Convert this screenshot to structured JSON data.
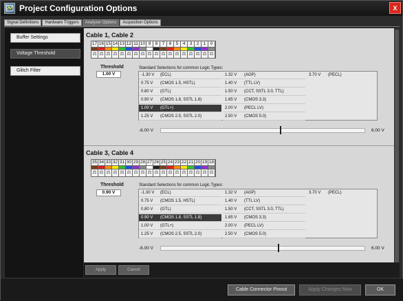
{
  "window": {
    "title": "Project Configuration Options",
    "close_label": "X"
  },
  "tabs": [
    {
      "label": "Signal Definitions",
      "active": false
    },
    {
      "label": "Hardware Triggers",
      "active": false
    },
    {
      "label": "Analyzer Options",
      "active": true
    },
    {
      "label": "Acquisition Options",
      "active": false
    }
  ],
  "sidebar": {
    "items": [
      {
        "label": "Buffer Settings",
        "active": false
      },
      {
        "label": "Voltage Threshold",
        "active": true
      },
      {
        "label": "Glitch Filter",
        "active": false
      }
    ]
  },
  "sections": [
    {
      "title": "Cable 1, Cable 2",
      "channels": [
        "17",
        "16",
        "15",
        "14",
        "13",
        "12",
        "11",
        "10",
        "9",
        "8",
        "7",
        "6",
        "5",
        "4",
        "3",
        "2",
        "1",
        "0"
      ],
      "channel_colors": [
        "#7a3e1c",
        "#e02020",
        "#ff8c00",
        "#ffe800",
        "#30c030",
        "#2050e0",
        "#9030d0",
        "#888888",
        "#ffffff",
        "#222222",
        "#7a3e1c",
        "#e02020",
        "#ff8c00",
        "#ffe800",
        "#30c030",
        "#2050e0",
        "#9030d0",
        "#888888"
      ],
      "threshold_label": "Threshold",
      "threshold_value": "1.00 V",
      "std_label": "Standard Selections for common Logic Types:",
      "options": [
        {
          "v": "-1.30 V",
          "t": "(ECL)"
        },
        {
          "v": "0.75 V",
          "t": "(CMOS 1.5, HSTL)"
        },
        {
          "v": "0.80 V",
          "t": "(GTL)"
        },
        {
          "v": "0.90 V",
          "t": "(CMOS 1.8, SSTL 1.8)"
        },
        {
          "v": "1.00 V",
          "t": "(GTL+)"
        },
        {
          "v": "1.25 V",
          "t": "(CMOS 2.5, SSTL 2.0)"
        },
        {
          "v": "1.32 V",
          "t": "(AGP)"
        },
        {
          "v": "1.40 V",
          "t": "(TTL LV)"
        },
        {
          "v": "1.50 V",
          "t": "(CCT, SSTL 3.0, TTL)"
        },
        {
          "v": "1.65 V",
          "t": "(CMOS 3.3)"
        },
        {
          "v": "2.00 V",
          "t": "(PECL LV)"
        },
        {
          "v": "2.50 V",
          "t": "(CMOS 5.0)"
        },
        {
          "v": "3.70 V",
          "t": "(PECL)"
        }
      ],
      "selected_index": 4,
      "slider_min": "-6.00 V",
      "slider_max": "6.00 V",
      "slider_value": 1.0
    },
    {
      "title": "Cable 3, Cable 4",
      "channels": [
        "35",
        "34",
        "33",
        "32",
        "31",
        "30",
        "29",
        "28",
        "27",
        "26",
        "25",
        "24",
        "23",
        "22",
        "21",
        "20",
        "19",
        "18"
      ],
      "channel_colors": [
        "#7a3e1c",
        "#e02020",
        "#ff8c00",
        "#ffe800",
        "#30c030",
        "#2050e0",
        "#9030d0",
        "#888888",
        "#ffffff",
        "#222222",
        "#7a3e1c",
        "#e02020",
        "#ff8c00",
        "#ffe800",
        "#30c030",
        "#2050e0",
        "#9030d0",
        "#888888"
      ],
      "threshold_label": "Threshold",
      "threshold_value": "0.90 V",
      "std_label": "Standard Selections for common Logic Types:",
      "options": [
        {
          "v": "-1.30 V",
          "t": "(ECL)"
        },
        {
          "v": "0.75 V",
          "t": "(CMOS 1.5, HSTL)"
        },
        {
          "v": "0.80 V",
          "t": "(GTL)"
        },
        {
          "v": "0.90 V",
          "t": "(CMOS 1.8, SSTL 1.8)"
        },
        {
          "v": "1.00 V",
          "t": "(GTL+)"
        },
        {
          "v": "1.25 V",
          "t": "(CMOS 2.5, SSTL 2.0)"
        },
        {
          "v": "1.32 V",
          "t": "(AGP)"
        },
        {
          "v": "1.40 V",
          "t": "(TTL LV)"
        },
        {
          "v": "1.50 V",
          "t": "(CCT, SSTL 3.0, TTL)"
        },
        {
          "v": "1.65 V",
          "t": "(CMOS 3.3)"
        },
        {
          "v": "2.00 V",
          "t": "(PECL LV)"
        },
        {
          "v": "2.50 V",
          "t": "(CMOS 5.0)"
        },
        {
          "v": "3.70 V",
          "t": "(PECL)"
        }
      ],
      "selected_index": 3,
      "slider_min": "-6.00 V",
      "slider_max": "6.00 V",
      "slider_value": 0.9
    }
  ],
  "panel_buttons": {
    "apply": "Apply",
    "cancel": "Cancel"
  },
  "footer": {
    "pinout": "Cable Connector Pinout",
    "apply_changes": "Apply Changes Now",
    "ok": "OK"
  }
}
